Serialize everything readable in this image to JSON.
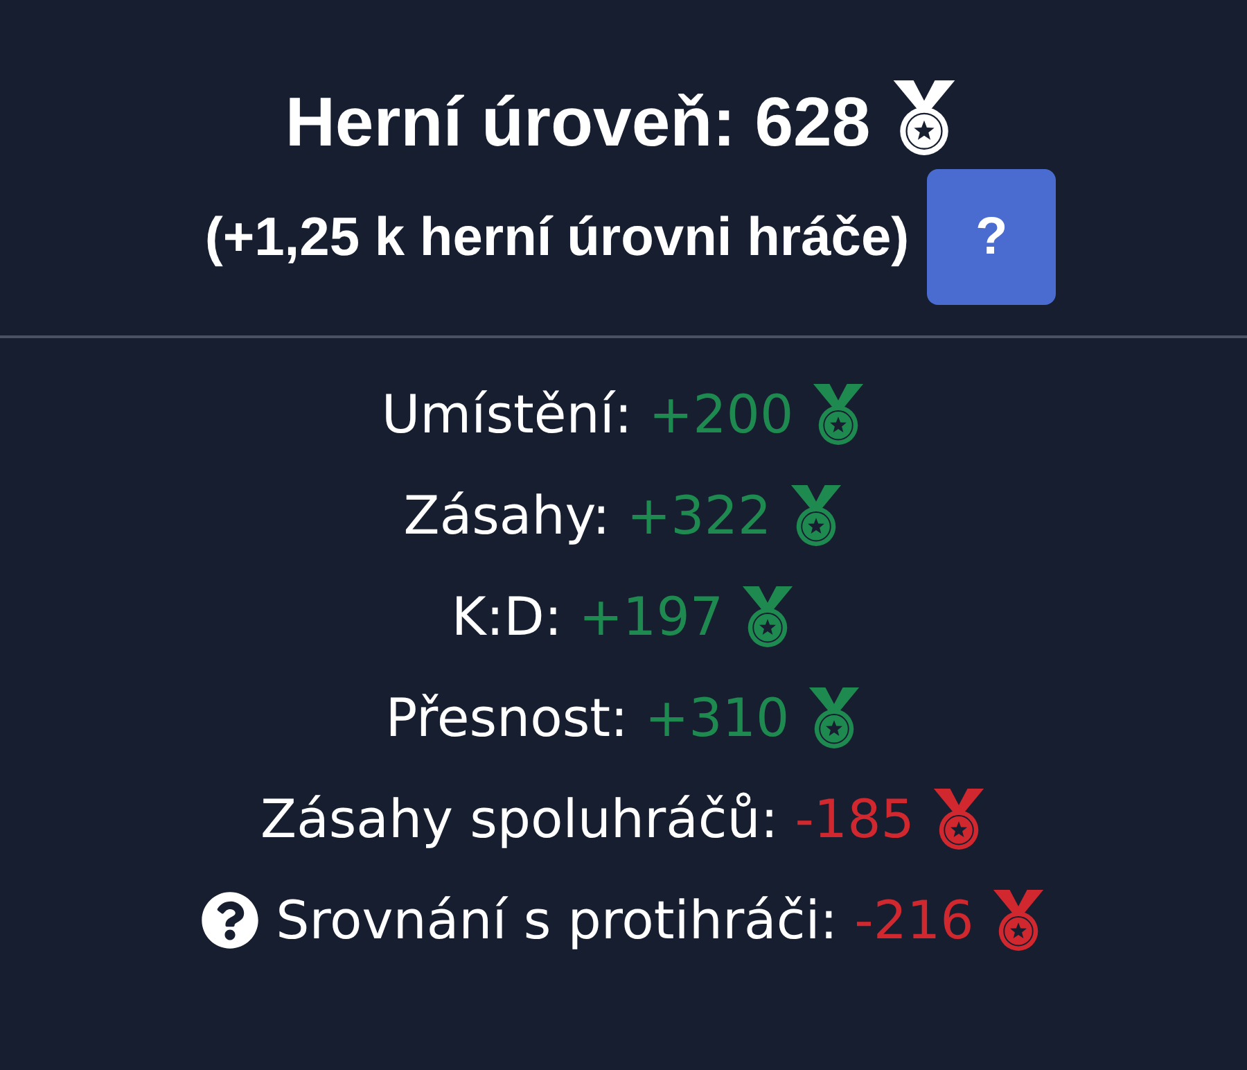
{
  "header": {
    "title": "Herní úroveň: 628",
    "subtitle": "(+1,25 k herní úrovni hráče)",
    "help_button": "?"
  },
  "stats": [
    {
      "label": "Umístění:",
      "value": "+200",
      "color": "#1e8a50",
      "help_icon": false
    },
    {
      "label": "Zásahy:",
      "value": "+322",
      "color": "#1e8a50",
      "help_icon": false
    },
    {
      "label": "K:D:",
      "value": "+197",
      "color": "#1e8a50",
      "help_icon": false
    },
    {
      "label": "Přesnost:",
      "value": "+310",
      "color": "#1e8a50",
      "help_icon": false
    },
    {
      "label": "Zásahy spoluhráčů:",
      "value": "-185",
      "color": "#d0282e",
      "help_icon": false
    },
    {
      "label": "Srovnání s protihráči:",
      "value": "-216",
      "color": "#d0282e",
      "help_icon": true
    }
  ]
}
